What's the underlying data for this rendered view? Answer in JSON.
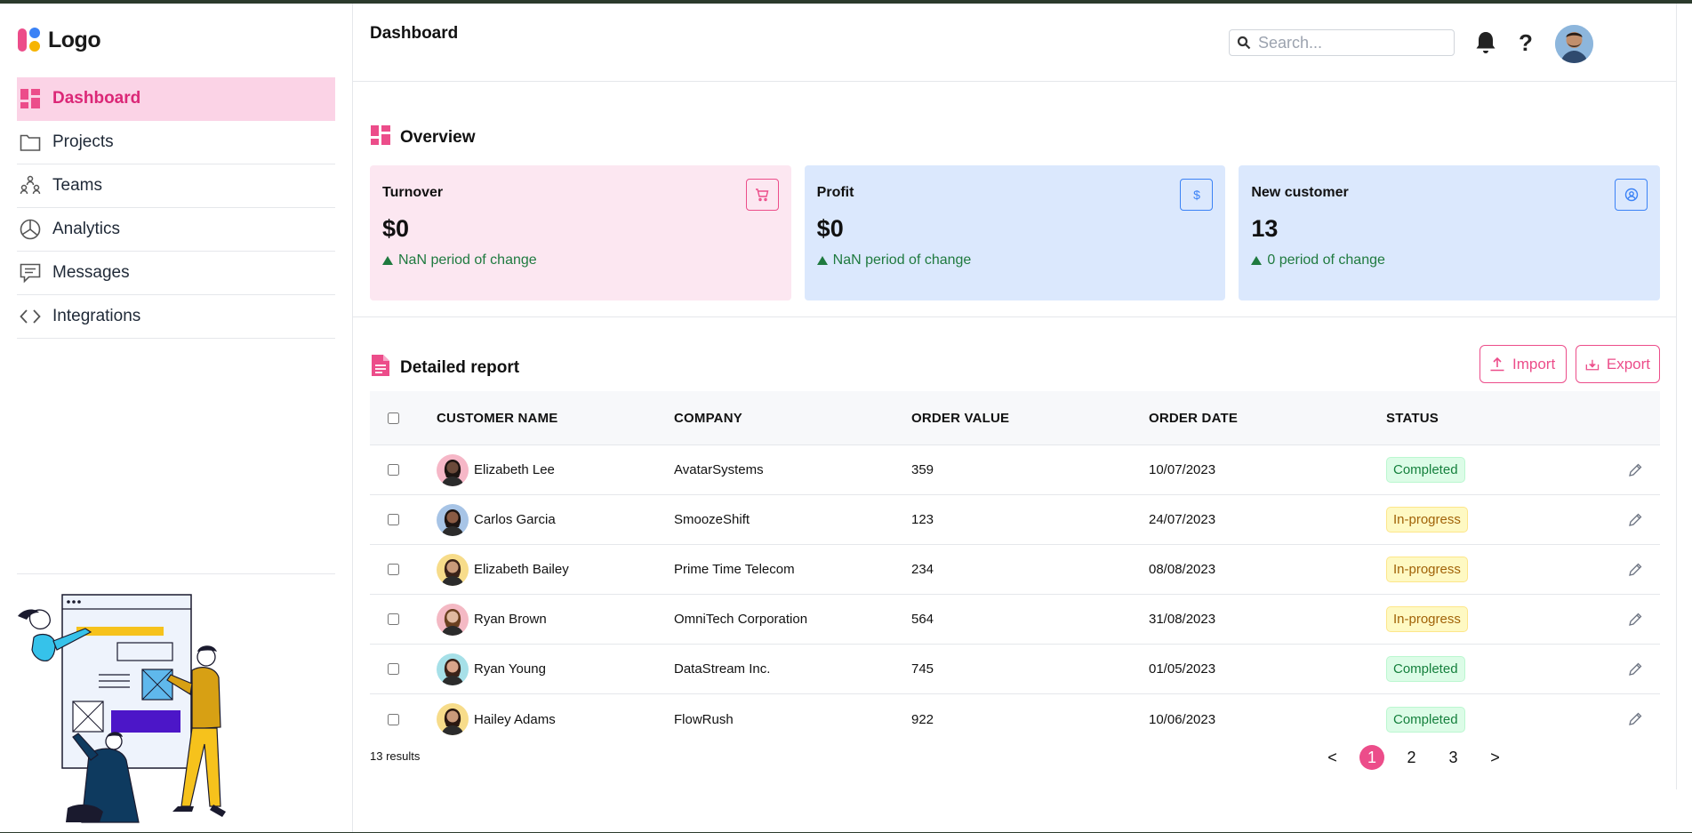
{
  "app": {
    "logo_text": "Logo",
    "page_title": "Dashboard"
  },
  "sidebar": {
    "items": [
      {
        "label": "Dashboard",
        "icon": "dashboard-icon",
        "active": true
      },
      {
        "label": "Projects",
        "icon": "folder-icon"
      },
      {
        "label": "Teams",
        "icon": "teams-icon"
      },
      {
        "label": "Analytics",
        "icon": "pie-chart-icon"
      },
      {
        "label": "Messages",
        "icon": "message-icon"
      },
      {
        "label": "Integrations",
        "icon": "code-icon"
      }
    ]
  },
  "header": {
    "search_placeholder": "Search...",
    "help_label": "?"
  },
  "overview": {
    "title": "Overview",
    "cards": [
      {
        "title": "Turnover",
        "value": "$0",
        "change": "NaN period of change",
        "icon": "cart-icon"
      },
      {
        "title": "Profit",
        "value": "$0",
        "change": "NaN period of change",
        "icon": "dollar-icon"
      },
      {
        "title": "New customer",
        "value": "13",
        "change": "0 period of change",
        "icon": "user-circle-icon"
      }
    ]
  },
  "report": {
    "title": "Detailed report",
    "import_label": "Import",
    "export_label": "Export",
    "columns": [
      "CUSTOMER NAME",
      "COMPANY",
      "ORDER VALUE",
      "ORDER DATE",
      "STATUS"
    ],
    "rows": [
      {
        "name": "Elizabeth Lee",
        "company": "AvatarSystems",
        "value": "359",
        "date": "10/07/2023",
        "status": "Completed"
      },
      {
        "name": "Carlos Garcia",
        "company": "SmoozeShift",
        "value": "123",
        "date": "24/07/2023",
        "status": "In-progress"
      },
      {
        "name": "Elizabeth Bailey",
        "company": "Prime Time Telecom",
        "value": "234",
        "date": "08/08/2023",
        "status": "In-progress"
      },
      {
        "name": "Ryan Brown",
        "company": "OmniTech Corporation",
        "value": "564",
        "date": "31/08/2023",
        "status": "In-progress"
      },
      {
        "name": "Ryan Young",
        "company": "DataStream Inc.",
        "value": "745",
        "date": "01/05/2023",
        "status": "Completed"
      },
      {
        "name": "Hailey Adams",
        "company": "FlowRush",
        "value": "922",
        "date": "10/06/2023",
        "status": "Completed"
      }
    ],
    "results_text": "13 results",
    "pagination": {
      "prev": "<",
      "pages": [
        "1",
        "2",
        "3"
      ],
      "current": "1",
      "next": ">"
    }
  },
  "colors": {
    "accent": "#ec4d8a",
    "accent_bg": "#fbd3e6",
    "card_pink": "#fce7f1",
    "card_blue": "#dbe8fd",
    "success": "#15803d",
    "warning": "#a16207"
  }
}
